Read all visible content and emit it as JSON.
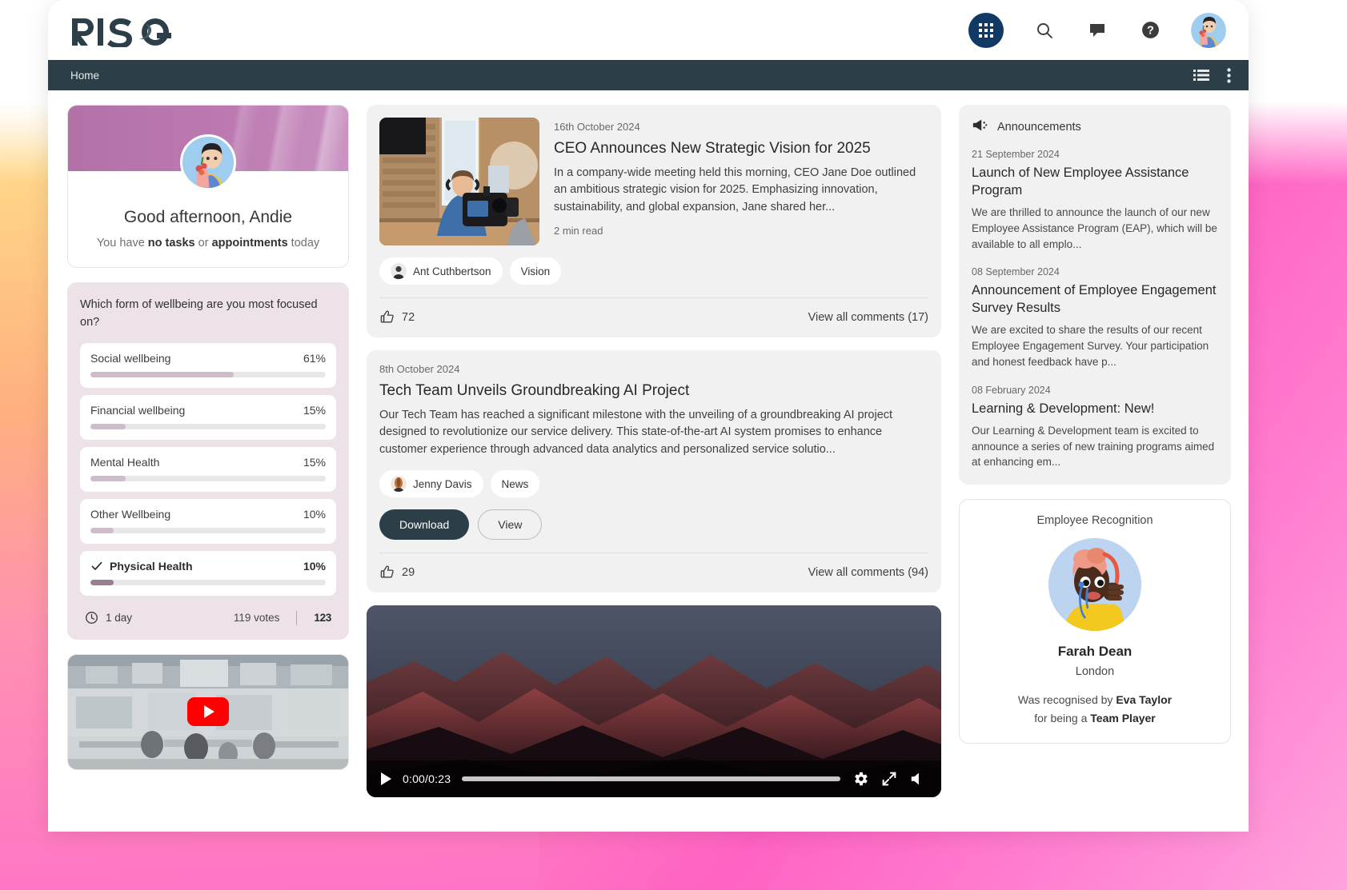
{
  "brand": {
    "logo_text": "RISE",
    "accent_dark": "#2c3e47",
    "apps_circle_color": "#103a63"
  },
  "topbar": {
    "icons": [
      {
        "name": "apps-grid-icon",
        "label": "Apps"
      },
      {
        "name": "search-icon",
        "label": "Search"
      },
      {
        "name": "chat-icon",
        "label": "Chat"
      },
      {
        "name": "help-icon",
        "label": "Help"
      },
      {
        "name": "user-avatar",
        "label": "Account"
      }
    ]
  },
  "navbar": {
    "home_label": "Home",
    "list_icon": "list-view-icon",
    "more_icon": "more-vertical-icon"
  },
  "profile": {
    "greeting": "Good afternoon, Andie",
    "tasks_prefix": "You have ",
    "tasks_bold": "no tasks",
    "tasks_mid": " or ",
    "appointments_bold": "appointments",
    "tasks_suffix": " today"
  },
  "poll": {
    "question": "Which form of wellbeing are you most focused on?",
    "options": [
      {
        "label": "Social wellbeing",
        "pct": "61%",
        "value": 61,
        "selected": false
      },
      {
        "label": "Financial wellbeing",
        "pct": "15%",
        "value": 15,
        "selected": false
      },
      {
        "label": "Mental Health",
        "pct": "15%",
        "value": 15,
        "selected": false
      },
      {
        "label": "Other Wellbeing",
        "pct": "10%",
        "value": 10,
        "selected": false
      },
      {
        "label": "Physical Health",
        "pct": "10%",
        "value": 10,
        "selected": true
      }
    ],
    "time_left": "1 day",
    "votes": "119 votes",
    "count": "123"
  },
  "news": [
    {
      "date": "16th October 2024",
      "title": "CEO Announces New Strategic Vision for 2025",
      "excerpt": "In a company-wide meeting held this morning, CEO Jane Doe outlined an ambitious strategic vision for 2025. Emphasizing innovation, sustainability, and global expansion, Jane shared her...",
      "read_time": "2 min read",
      "author": "Ant Cuthbertson",
      "tag": "Vision",
      "likes": "72",
      "comments": "View all comments (17)"
    },
    {
      "date": "8th October 2024",
      "title": "Tech Team Unveils Groundbreaking AI Project",
      "excerpt": "Our Tech Team has reached a significant milestone with the unveiling of a groundbreaking AI project designed to revolutionize our service delivery. This state-of-the-art AI system promises to enhance customer experience through advanced data analytics and personalized service solutio...",
      "author": "Jenny Davis",
      "tag": "News",
      "download_label": "Download",
      "view_label": "View",
      "likes": "29",
      "comments": "View all comments (94)"
    }
  ],
  "video": {
    "time": "0:00/0:23",
    "play_icon": "play-icon",
    "settings_icon": "gear-icon",
    "fullscreen_icon": "fullscreen-icon",
    "volume_icon": "volume-icon",
    "progress_pct": 0
  },
  "announcements": {
    "header": "Announcements",
    "header_icon": "megaphone-icon",
    "items": [
      {
        "date": "21 September 2024",
        "title": "Launch of New Employee Assistance Program",
        "body": "We are thrilled to announce the launch of our new Employee Assistance Program (EAP), which will be available to all emplo..."
      },
      {
        "date": "08 September 2024",
        "title": "Announcement of Employee Engagement Survey Results",
        "body": "We are excited to share the results of our recent Employee Engagement Survey. Your participation and honest feedback have p..."
      },
      {
        "date": "08 February 2024",
        "title": "Learning & Development: New!",
        "body": "Our Learning & Development team is excited to announce a series of new training programs aimed at enhancing em..."
      }
    ]
  },
  "recognition": {
    "header": "Employee Recognition",
    "name": "Farah Dean",
    "location": "London",
    "by_prefix": "Was recognised by ",
    "by_name": "Eva Taylor",
    "reason_prefix": "for being a ",
    "reason_value": "Team Player"
  }
}
